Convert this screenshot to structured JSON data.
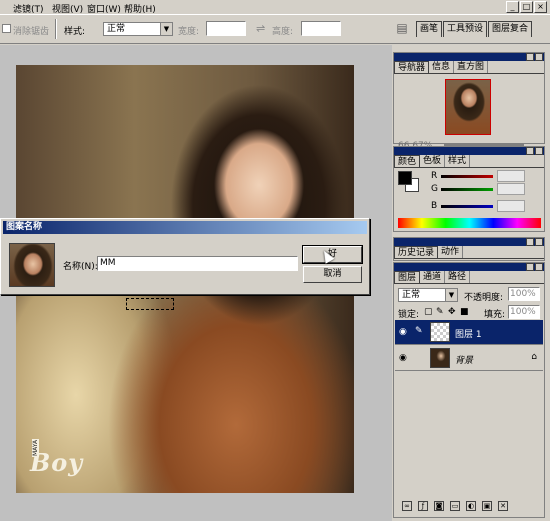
{
  "menu": {
    "items": [
      {
        "label": "滤镜(T)"
      },
      {
        "label": "视图(V)"
      },
      {
        "label": "窗口(W)"
      },
      {
        "label": "帮助(H)"
      }
    ],
    "window_buttons": [
      "_",
      "□",
      "×"
    ]
  },
  "options_bar": {
    "erase_label": "消除锯齿",
    "style_label": "样式:",
    "style_value": "正常",
    "width_label": "宽度:",
    "height_label": "高度:",
    "swap_icon": "⇌"
  },
  "palette_well": {
    "tabs": [
      "画笔",
      "工具预设",
      "图层复合"
    ]
  },
  "canvas": {
    "logo_text": "Boy",
    "logo_tag": "MAYA"
  },
  "dialog": {
    "title": "图案名称",
    "name_label": "名称(N):",
    "name_value": "MM",
    "ok_label": "好",
    "cancel_label": "取消"
  },
  "navigator_panel": {
    "tabs": [
      "导航器",
      "信息",
      "直方图"
    ],
    "zoom": "66.67%"
  },
  "color_panel": {
    "tabs": [
      "颜色",
      "色板",
      "样式"
    ],
    "channels": [
      {
        "label": "R",
        "color": "#c00000"
      },
      {
        "label": "G",
        "color": "#00a000"
      },
      {
        "label": "B",
        "color": "#0000c0"
      }
    ]
  },
  "history_panel": {
    "tabs": [
      "历史记录",
      "动作"
    ]
  },
  "layers_panel": {
    "tabs": [
      "图层",
      "通道",
      "路径"
    ],
    "blend_mode": "正常",
    "opacity_label": "不透明度:",
    "opacity_value": "100%",
    "lock_label": "锁定:",
    "fill_label": "填充:",
    "fill_value": "100%",
    "layers": [
      {
        "name": "图层 1",
        "selected": true
      },
      {
        "name": "背景",
        "selected": false
      }
    ]
  },
  "colors": {
    "title_bar": "#0a246a",
    "chrome": "#d4d0c8"
  }
}
